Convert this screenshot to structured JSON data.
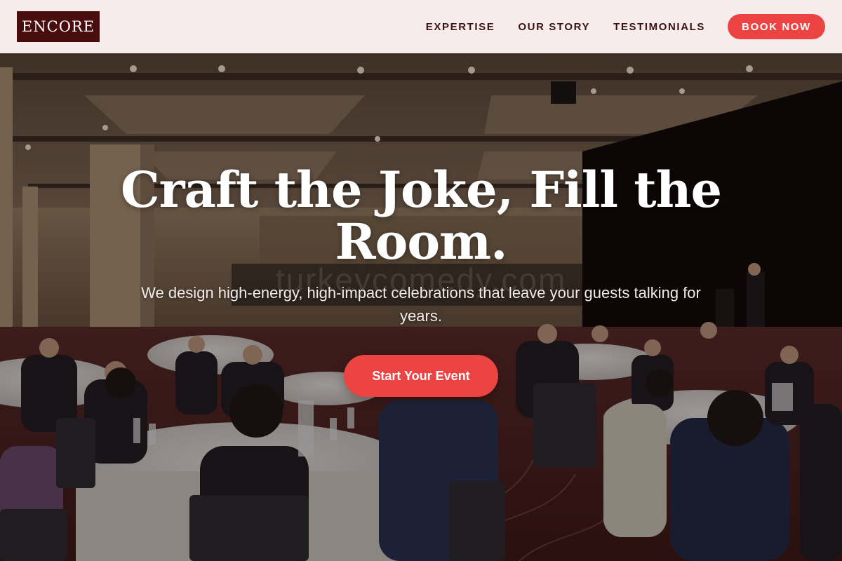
{
  "brand": {
    "logo_text": "ENCORE",
    "logo_bg": "#4a0d0d"
  },
  "nav": {
    "items": [
      {
        "label": "EXPERTISE"
      },
      {
        "label": "OUR STORY"
      },
      {
        "label": "TESTIMONIALS"
      }
    ],
    "cta_label": "BOOK NOW"
  },
  "hero": {
    "headline": "Craft the Joke, Fill the Room.",
    "subtitle": "We design high-energy, high-impact celebrations that leave your guests talking for years.",
    "cta_label": "Start Your Event",
    "watermark": "turkeycomedy.com",
    "image_description": "Ballroom event with guests seated at round tables facing a stage with a speaker at a lectern"
  },
  "colors": {
    "header_bg": "#f7ecec",
    "nav_text": "#3d1212",
    "accent": "#ec4343",
    "text_light": "#ffffff"
  }
}
